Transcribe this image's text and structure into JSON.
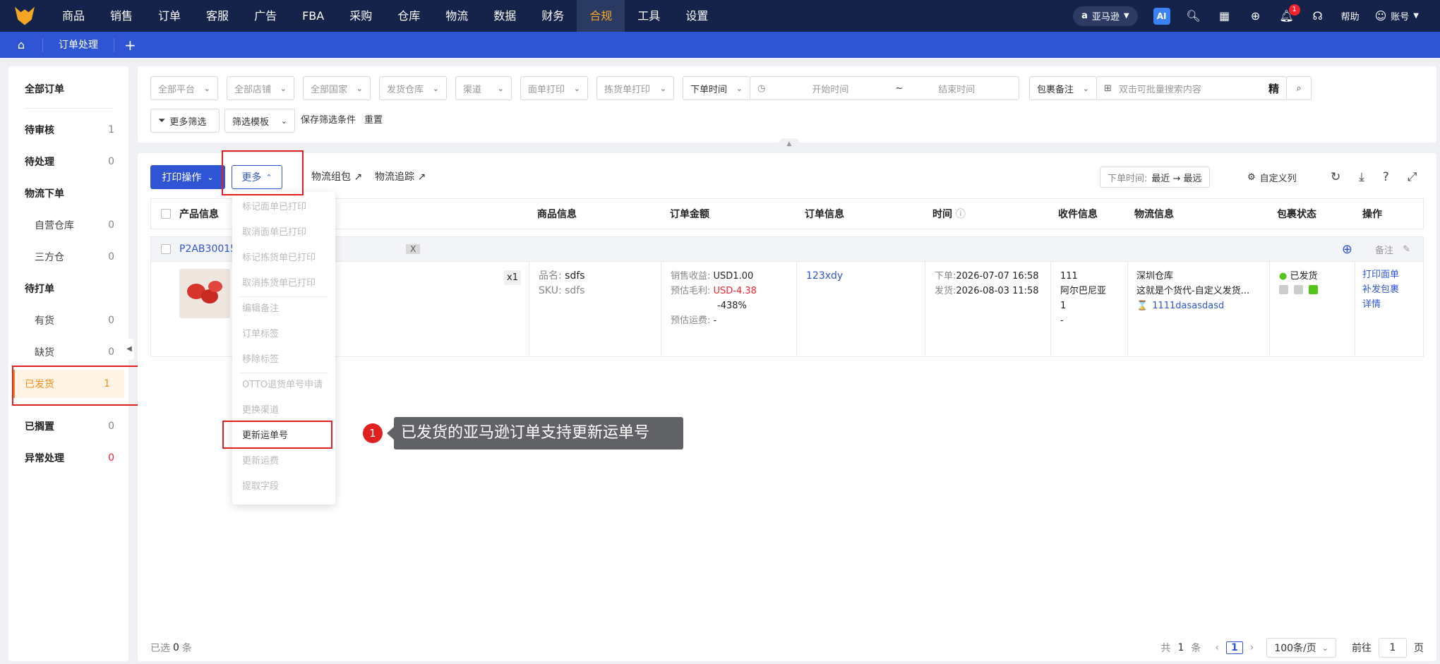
{
  "topnav": {
    "items": [
      "商品",
      "销售",
      "订单",
      "客服",
      "广告",
      "FBA",
      "采购",
      "仓库",
      "物流",
      "数据",
      "财务",
      "合规",
      "工具",
      "设置"
    ],
    "active": "合规",
    "store": "亚马逊",
    "ai_label": "AI",
    "notification_count": "1",
    "help": "帮助",
    "account": "账号"
  },
  "tabs": {
    "current": "订单处理",
    "plus": "+"
  },
  "sidebar": {
    "items": [
      {
        "label": "全部订单",
        "count": ""
      },
      {
        "label": "待审核",
        "count": "1"
      },
      {
        "label": "待处理",
        "count": "0"
      },
      {
        "label": "物流下单",
        "count": ""
      },
      {
        "label": "自营仓库",
        "count": "0"
      },
      {
        "label": "三方仓",
        "count": "0"
      },
      {
        "label": "待打单",
        "count": ""
      },
      {
        "label": "有货",
        "count": "0"
      },
      {
        "label": "缺货",
        "count": "0"
      },
      {
        "label": "已发货",
        "count": "1"
      },
      {
        "label": "已搁置",
        "count": "0"
      },
      {
        "label": "异常处理",
        "count": "0"
      }
    ]
  },
  "filters": {
    "platform": "全部平台",
    "shop": "全部店铺",
    "country": "全部国家",
    "warehouse": "发货仓库",
    "channel": "渠道",
    "label_print": "面单打印",
    "pick_print": "拣货单打印",
    "time_type": "下单时间",
    "start_placeholder": "开始时间",
    "range_sep": "~",
    "end_placeholder": "结束时间",
    "remark_type": "包裹备注",
    "search_placeholder": "双击可批量搜索内容",
    "precise": "精",
    "more_filters": "更多筛选",
    "template": "筛选模板",
    "save": "保存筛选条件",
    "reset": "重置"
  },
  "toolbar": {
    "print": "打印操作",
    "more": "更多",
    "group": "物流组包",
    "track": "物流追踪",
    "sort_label": "下单时间:",
    "sort_value": "最近 → 最远",
    "custom_cols": "自定义列"
  },
  "table": {
    "headers": [
      "产品信息",
      "商品信息",
      "订单金额",
      "订单信息",
      "时间",
      "收件信息",
      "物流信息",
      "包裹状态",
      "操作"
    ],
    "group": {
      "order_no": "P2AB30015",
      "masked": "X",
      "remark": "备注"
    },
    "row": {
      "qty": "x1",
      "name_label": "品名:",
      "name": "sdfs",
      "sku_label": "SKU:",
      "sku": "sdfs",
      "revenue_label": "销售收益:",
      "revenue": "USD1.00",
      "profit_label": "预估毛利:",
      "profit": "USD-4.38",
      "profit_pct": "-438%",
      "ship_label": "预估运费:",
      "ship": "-",
      "order_id": "123xdy",
      "ordered_label": "下单:",
      "ordered": "2026-07-07 16:58",
      "shipped_label": "发货:",
      "shipped": "2026-08-03 11:58",
      "recv_name": "111",
      "recv_country": "阿尔巴尼亚",
      "recv_qty": "1",
      "recv_extra": "-",
      "warehouse": "深圳仓库",
      "carrier": "这就是个货代-自定义发货...",
      "tracking": "1111dasasdasd",
      "status": "已发货",
      "actions": [
        "打印面单",
        "补发包裹",
        "详情"
      ]
    }
  },
  "dropdown": {
    "items": [
      "标记面单已打印",
      "取消面单已打印",
      "标记拣货单已打印",
      "取消拣货单已打印",
      "编辑备注",
      "订单标签",
      "移除标签",
      "OTTO退货单号申请",
      "更换渠道",
      "更新运单号",
      "更新运费",
      "提取字段"
    ]
  },
  "tip": {
    "num": "1",
    "text": "已发货的亚马逊订单支持更新运单号"
  },
  "footer": {
    "selected_prefix": "已选",
    "selected": "0",
    "selected_suffix": "条",
    "total_prefix": "共",
    "total": "1",
    "total_suffix": "条",
    "page": "1",
    "page_size": "100条/页",
    "goto": "前往",
    "goto_page": "1",
    "page_unit": "页"
  },
  "colors": {
    "nav": "#15234a",
    "accent": "#f5a623",
    "primary": "#2f55d4",
    "highlight": "#e02020"
  }
}
